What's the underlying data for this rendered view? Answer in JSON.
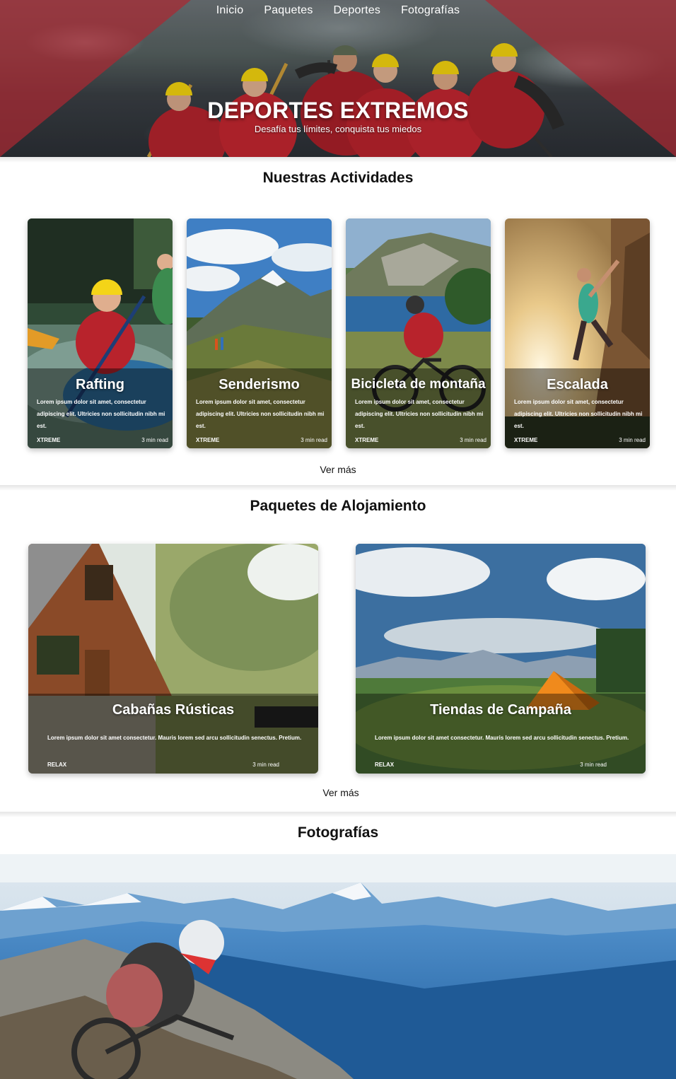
{
  "nav": {
    "items": [
      "Inicio",
      "Paquetes",
      "Deportes",
      "Fotografías"
    ]
  },
  "hero": {
    "title": "DEPORTES EXTREMOS",
    "subtitle": "Desafía tus límites, conquista tus miedos"
  },
  "activities": {
    "title": "Nuestras Actividades",
    "cards": [
      {
        "title": "Rafting",
        "desc": "Lorem ipsum dolor sit amet, consectetur adipiscing elit. Ultricies non sollicitudin nibh mi est.",
        "tag": "XTREME",
        "read": "3 min read"
      },
      {
        "title": "Senderismo",
        "desc": "Lorem ipsum dolor sit amet, consectetur adipiscing elit. Ultricies non sollicitudin nibh mi est.",
        "tag": "XTREME",
        "read": "3 min read"
      },
      {
        "title": "Bicicleta de montaña",
        "desc": "Lorem ipsum dolor sit amet, consectetur adipiscing elit. Ultricies non sollicitudin nibh mi est.",
        "tag": "XTREME",
        "read": "3 min read"
      },
      {
        "title": "Escalada",
        "desc": "Lorem ipsum dolor sit amet, consectetur adipiscing elit. Ultricies non sollicitudin nibh mi est.",
        "tag": "XTREME",
        "read": "3 min read"
      }
    ],
    "more": "Ver más"
  },
  "packages": {
    "title": "Paquetes de Alojamiento",
    "cards": [
      {
        "title": "Cabañas Rústicas",
        "desc": "Lorem ipsum dolor sit amet consectetur. Mauris lorem sed arcu sollicitudin senectus. Pretium.",
        "tag": "RELAX",
        "read": "3 min read"
      },
      {
        "title": "Tiendas de Campaña",
        "desc": "Lorem ipsum dolor sit amet consectetur. Mauris lorem sed arcu sollicitudin senectus. Pretium.",
        "tag": "RELAX",
        "read": "3 min read"
      }
    ],
    "more": "Ver más"
  },
  "photos": {
    "title": "Fotografías"
  },
  "colors": {
    "hero_accent": "#aa2832",
    "text": "#111111",
    "background": "#ffffff"
  }
}
